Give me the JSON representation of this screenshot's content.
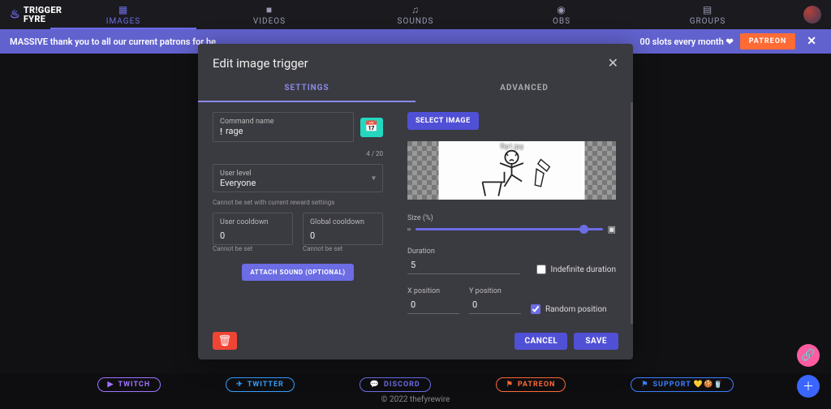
{
  "logo": {
    "line1": "TR!GGER",
    "line2": "FYRE"
  },
  "nav": {
    "images": "IMAGES",
    "videos": "VIDEOS",
    "sounds": "SOUNDS",
    "obs": "OBS",
    "groups": "GROUPS"
  },
  "banner": {
    "left": "MASSIVE thank you to all our current patrons for he",
    "right": "00 slots every month ❤",
    "patreon": "PATREON"
  },
  "footer": {
    "twitch": "TWITCH",
    "twitter": "TWITTER",
    "discord": "DISCORD",
    "patreon": "PATREON",
    "support": "SUPPORT 💛🍪🥤",
    "copyright": "© 2022 thefyrewire"
  },
  "modal": {
    "title": "Edit image trigger",
    "tabs": {
      "settings": "SETTINGS",
      "advanced": "ADVANCED"
    },
    "command": {
      "label": "Command name",
      "prefix": "!",
      "value": "rage",
      "counter": "4 / 20"
    },
    "level": {
      "label": "User level",
      "value": "Everyone",
      "helper": "Cannot be set with current reward settings"
    },
    "ucd": {
      "label": "User cooldown",
      "value": "0",
      "helper": "Cannot be set"
    },
    "gcd": {
      "label": "Global cooldown",
      "value": "0",
      "helper": "Cannot be set"
    },
    "attach": "ATTACH SOUND (OPTIONAL)",
    "selectImage": "SELECT IMAGE",
    "preview": {
      "filename": "flip1.jpg"
    },
    "sizeLabel": "Size (%)",
    "dur": {
      "label": "Duration",
      "value": "5"
    },
    "indef": "Indefinite duration",
    "xpos": {
      "label": "X position",
      "value": "0"
    },
    "ypos": {
      "label": "Y position",
      "value": "0"
    },
    "rand": "Random position",
    "cancel": "CANCEL",
    "save": "SAVE"
  }
}
